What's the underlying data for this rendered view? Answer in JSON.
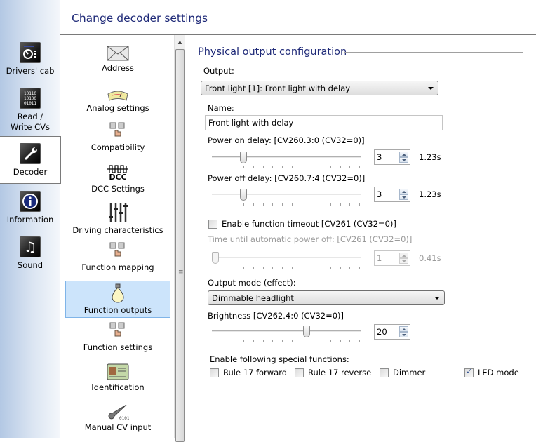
{
  "nav": {
    "items": [
      {
        "label": "Drivers' cab",
        "icon": "drivers-cab-icon",
        "glyph": "⏲"
      },
      {
        "label": "Read / Write CVs",
        "icon": "binary-cv-icon",
        "glyph": "01"
      },
      {
        "label": "Decoder",
        "icon": "wrench-icon",
        "glyph": "🔧",
        "active": true
      },
      {
        "label": "Information",
        "icon": "info-icon",
        "glyph": "i"
      },
      {
        "label": "Sound",
        "icon": "music-note-icon",
        "glyph": "♫"
      }
    ]
  },
  "header": {
    "title": "Change decoder settings"
  },
  "categories": [
    {
      "label": "Address",
      "icon": "envelope-icon"
    },
    {
      "label": "Analog settings",
      "icon": "gauge-icon"
    },
    {
      "label": "Compatibility",
      "icon": "function-keys-hand-icon"
    },
    {
      "label": "DCC Settings",
      "icon": "dcc-signal-icon",
      "icon_text": "DCC"
    },
    {
      "label": "Driving characteristics",
      "icon": "sliders-icon"
    },
    {
      "label": "Function mapping",
      "icon": "function-keys-hand-icon"
    },
    {
      "label": "Function outputs",
      "icon": "light-bulb-icon",
      "selected": true
    },
    {
      "label": "Function settings",
      "icon": "function-keys-hand-icon"
    },
    {
      "label": "Identification",
      "icon": "id-card-icon"
    },
    {
      "label": "Manual CV input",
      "icon": "wrench-binary-icon"
    }
  ],
  "panel": {
    "section_title": "Physical output configuration",
    "output_label": "Output:",
    "output_value": "Front light [1]: Front light with delay",
    "name_label": "Name:",
    "name_value": "Front light with delay",
    "power_on": {
      "label": "Power on delay: [CV260.3:0 (CV32=0)]",
      "value": "3",
      "readout": "1.23s",
      "fraction": 0.2
    },
    "power_off": {
      "label": "Power off delay: [CV260.7:4 (CV32=0)]",
      "value": "3",
      "readout": "1.23s",
      "fraction": 0.2
    },
    "timeout_check": {
      "label": "Enable function timeout [CV261 (CV32=0)]",
      "checked": false
    },
    "auto_off": {
      "label": "Time until automatic power off: [CV261 (CV32=0)]",
      "value": "1",
      "readout": "0.41s",
      "fraction": 0.0,
      "disabled": true
    },
    "mode_label": "Output mode (effect):",
    "mode_value": "Dimmable headlight",
    "brightness": {
      "label": "Brightness [CV262.4:0 (CV32=0)]",
      "value": "20",
      "fraction": 0.645
    },
    "special_label": "Enable following special functions:",
    "special": [
      {
        "label": "Rule 17 forward",
        "checked": false
      },
      {
        "label": "Rule 17 reverse",
        "checked": false
      },
      {
        "label": "Dimmer",
        "checked": false
      },
      {
        "label": "LED mode",
        "checked": true
      }
    ]
  }
}
